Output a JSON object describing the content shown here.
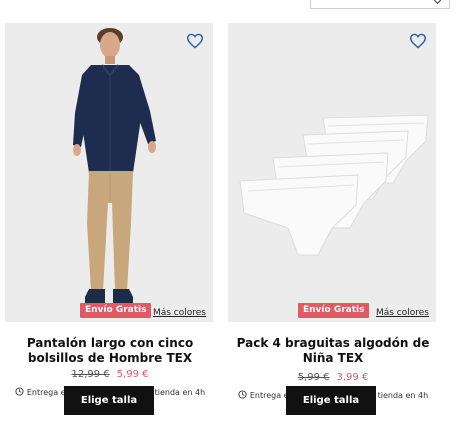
{
  "colors": {
    "badge": "#e05a66",
    "sale_price": "#e05a66",
    "button": "#111111",
    "image_bg": "#ececec"
  },
  "products": [
    {
      "badge": "Envío Gratis",
      "more_colors": "Más colores",
      "title": "Pantalón largo con cinco bolsillos de Hombre TEX",
      "old_price": "12,99 €",
      "new_price": "5,99 €",
      "delivery": "Entrega en el día / Recogida en tienda en 4h",
      "cta": "Elige talla",
      "wishlist_icon": "heart-icon"
    },
    {
      "badge": "Envío Gratis",
      "more_colors": "Más colores",
      "title": "Pack 4 braguitas algodón de Niña TEX",
      "old_price": "5,99 €",
      "new_price": "3,99 €",
      "delivery": "Entrega en el día / Recogida en tienda en 4h",
      "cta": "Elige talla",
      "wishlist_icon": "heart-icon"
    }
  ]
}
